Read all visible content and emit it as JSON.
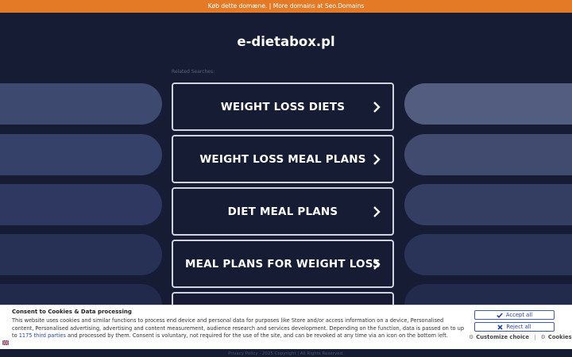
{
  "topbar": {
    "text": "Køb dette domæne. | More domains at Seo.Domains"
  },
  "site": {
    "title": "e-dietabox.pl",
    "related_label": "Related Searches:"
  },
  "searches": [
    {
      "label": "WEIGHT LOSS DIETS"
    },
    {
      "label": "WEIGHT LOSS MEAL PLANS"
    },
    {
      "label": "DIET MEAL PLANS"
    },
    {
      "label": "MEAL PLANS FOR WEIGHT LOSS"
    },
    {
      "label": ""
    }
  ],
  "footer": {
    "text": "Privacy Policy  ·  2025 Copyright | All Rights Reserved."
  },
  "consent": {
    "title": "Consent to Cookies & Data processing",
    "text_part1": "This website uses cookies and similar functions to process end device and personal data for purposes like Store and/or access information on a device, Personalised content, Personalised advertising, advertising and content measurement, audience research and services development. Depending on the function, data is passed on to up to ",
    "third_parties_link": "1175 third parties",
    "text_part2": " and processed by them. Consent is voluntary, not required for the use of the site, and can be revoked at any time via an icon on the bottom left.",
    "accept_label": "Accept all",
    "reject_label": "Reject all",
    "customize_label": "Customize choice",
    "cookies_label": "Cookies",
    "separator": "|"
  },
  "colors": {
    "background": "#151c33",
    "topbar": "#e47a26",
    "accent_link": "#2a45a8"
  }
}
